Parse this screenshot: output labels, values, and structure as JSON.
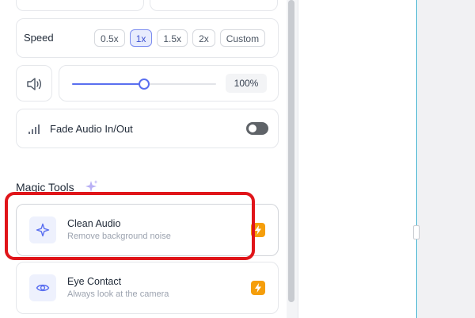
{
  "speed": {
    "label": "Speed",
    "options": [
      "0.5x",
      "1x",
      "1.5x",
      "2x",
      "Custom"
    ],
    "selected": "1x"
  },
  "volume": {
    "icon": "speaker-icon",
    "value_label": "100%",
    "level_percent": 100
  },
  "fade": {
    "icon": "signal-bars-icon",
    "label": "Fade Audio In/Out",
    "enabled": false
  },
  "magic_tools": {
    "title": "Magic Tools",
    "title_icon": "sparkle-icon",
    "tools": [
      {
        "name": "Clean Audio",
        "description": "Remove background noise",
        "icon": "sparkle-star-icon",
        "badge_icon": "lightning-icon"
      },
      {
        "name": "Eye Contact",
        "description": "Always look at the camera",
        "icon": "eye-icon",
        "badge_icon": "lightning-icon"
      }
    ]
  },
  "colors": {
    "accent": "#5a6ff0",
    "badge": "#f59e0b",
    "highlight": "#e0151a"
  }
}
